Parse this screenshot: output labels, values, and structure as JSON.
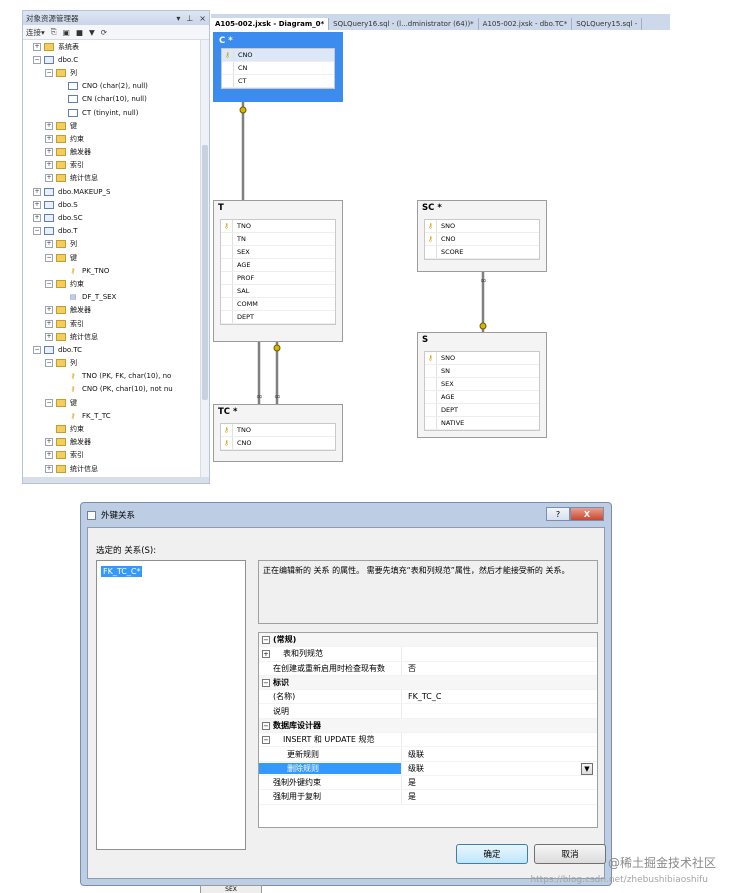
{
  "explorer": {
    "title": "对象资源管理器",
    "title_controls": [
      "▾",
      "⊥",
      "×"
    ],
    "toolbar": [
      "连接▾",
      "⎘",
      "▣",
      "■",
      "▼",
      "⟳"
    ],
    "tree": [
      {
        "indent": 1,
        "exp": "+",
        "icon": "folder",
        "label": "系统表"
      },
      {
        "indent": 1,
        "exp": "−",
        "icon": "table",
        "label": "dbo.C"
      },
      {
        "indent": 2,
        "exp": "−",
        "icon": "folder",
        "label": "列"
      },
      {
        "indent": 3,
        "exp": "",
        "icon": "col",
        "label": "CNO (char(2), null)"
      },
      {
        "indent": 3,
        "exp": "",
        "icon": "col",
        "label": "CN (char(10), null)"
      },
      {
        "indent": 3,
        "exp": "",
        "icon": "col",
        "label": "CT (tinyint, null)"
      },
      {
        "indent": 2,
        "exp": "+",
        "icon": "folder",
        "label": "键"
      },
      {
        "indent": 2,
        "exp": "+",
        "icon": "folder",
        "label": "约束"
      },
      {
        "indent": 2,
        "exp": "+",
        "icon": "folder",
        "label": "触发器"
      },
      {
        "indent": 2,
        "exp": "+",
        "icon": "folder",
        "label": "索引"
      },
      {
        "indent": 2,
        "exp": "+",
        "icon": "folder",
        "label": "统计信息"
      },
      {
        "indent": 1,
        "exp": "+",
        "icon": "table",
        "label": "dbo.MAKEUP_S"
      },
      {
        "indent": 1,
        "exp": "+",
        "icon": "table",
        "label": "dbo.S"
      },
      {
        "indent": 1,
        "exp": "+",
        "icon": "table",
        "label": "dbo.SC"
      },
      {
        "indent": 1,
        "exp": "−",
        "icon": "table",
        "label": "dbo.T"
      },
      {
        "indent": 2,
        "exp": "+",
        "icon": "folder",
        "label": "列"
      },
      {
        "indent": 2,
        "exp": "−",
        "icon": "folder",
        "label": "键"
      },
      {
        "indent": 3,
        "exp": "",
        "icon": "key",
        "label": "PK_TNO"
      },
      {
        "indent": 2,
        "exp": "−",
        "icon": "folder",
        "label": "约束"
      },
      {
        "indent": 3,
        "exp": "",
        "icon": "cons",
        "label": "DF_T_SEX"
      },
      {
        "indent": 2,
        "exp": "+",
        "icon": "folder",
        "label": "触发器"
      },
      {
        "indent": 2,
        "exp": "+",
        "icon": "folder",
        "label": "索引"
      },
      {
        "indent": 2,
        "exp": "+",
        "icon": "folder",
        "label": "统计信息"
      },
      {
        "indent": 1,
        "exp": "−",
        "icon": "table",
        "label": "dbo.TC"
      },
      {
        "indent": 2,
        "exp": "−",
        "icon": "folder",
        "label": "列"
      },
      {
        "indent": 3,
        "exp": "",
        "icon": "key",
        "label": "TNO (PK, FK, char(10), no"
      },
      {
        "indent": 3,
        "exp": "",
        "icon": "key",
        "label": "CNO (PK, char(10), not nu"
      },
      {
        "indent": 2,
        "exp": "−",
        "icon": "folder",
        "label": "键"
      },
      {
        "indent": 3,
        "exp": "",
        "icon": "key",
        "label": "FK_T_TC"
      },
      {
        "indent": 2,
        "exp": "",
        "icon": "folder",
        "label": "约束"
      },
      {
        "indent": 2,
        "exp": "+",
        "icon": "folder",
        "label": "触发器"
      },
      {
        "indent": 2,
        "exp": "+",
        "icon": "folder",
        "label": "索引"
      },
      {
        "indent": 2,
        "exp": "+",
        "icon": "folder",
        "label": "统计信息"
      }
    ]
  },
  "tabs": [
    {
      "label": "A105-002.jxsk - Diagram_0*",
      "active": true
    },
    {
      "label": "SQLQuery16.sql - (l...dministrator (64))*",
      "active": false
    },
    {
      "label": "A105-002.jxsk - dbo.TC*",
      "active": false
    },
    {
      "label": "SQLQuery15.sql -",
      "active": false
    }
  ],
  "diagram": {
    "tables": [
      {
        "id": "C",
        "title": "C *",
        "selected": true,
        "columns": [
          {
            "name": "CNO",
            "key": true
          },
          {
            "name": "CN",
            "key": false
          },
          {
            "name": "CT",
            "key": false
          }
        ]
      },
      {
        "id": "T",
        "title": "T",
        "selected": false,
        "columns": [
          {
            "name": "TNO",
            "key": true
          },
          {
            "name": "TN",
            "key": false
          },
          {
            "name": "SEX",
            "key": false
          },
          {
            "name": "AGE",
            "key": false
          },
          {
            "name": "PROF",
            "key": false
          },
          {
            "name": "SAL",
            "key": false
          },
          {
            "name": "COMM",
            "key": false
          },
          {
            "name": "DEPT",
            "key": false
          }
        ]
      },
      {
        "id": "SC",
        "title": "SC *",
        "selected": false,
        "columns": [
          {
            "name": "SNO",
            "key": true
          },
          {
            "name": "CNO",
            "key": true
          },
          {
            "name": "SCORE",
            "key": false
          }
        ]
      },
      {
        "id": "S",
        "title": "S",
        "selected": false,
        "columns": [
          {
            "name": "SNO",
            "key": true
          },
          {
            "name": "SN",
            "key": false
          },
          {
            "name": "SEX",
            "key": false
          },
          {
            "name": "AGE",
            "key": false
          },
          {
            "name": "DEPT",
            "key": false
          },
          {
            "name": "NATIVE",
            "key": false
          }
        ]
      },
      {
        "id": "TC",
        "title": "TC *",
        "selected": false,
        "columns": [
          {
            "name": "TNO",
            "key": true
          },
          {
            "name": "CNO",
            "key": true
          }
        ]
      }
    ]
  },
  "dialog": {
    "title": "外键关系",
    "help_label": "?",
    "close_label": "X",
    "selected_label": "选定的 关系(S):",
    "relation_item": "FK_TC_C*",
    "description": "正在编辑新的 关系 的属性。 需要先填充“表和列规范”属性，然后才能接受新的 关系。",
    "properties": [
      {
        "kind": "cat",
        "exp": "−",
        "label": "(常规)",
        "value": ""
      },
      {
        "kind": "sub2",
        "exp": "+",
        "label": "表和列规范",
        "value": ""
      },
      {
        "kind": "prop",
        "exp": "",
        "label": "在创建或重新启用时检查现有数",
        "value": "否"
      },
      {
        "kind": "cat",
        "exp": "−",
        "label": "标识",
        "value": ""
      },
      {
        "kind": "prop",
        "exp": "",
        "label": "(名称)",
        "value": "FK_TC_C"
      },
      {
        "kind": "prop",
        "exp": "",
        "label": "说明",
        "value": ""
      },
      {
        "kind": "cat",
        "exp": "−",
        "label": "数据库设计器",
        "value": ""
      },
      {
        "kind": "sub2",
        "exp": "−",
        "label": "INSERT 和 UPDATE 规范",
        "value": ""
      },
      {
        "kind": "sub",
        "exp": "",
        "label": "更新规则",
        "value": "级联"
      },
      {
        "kind": "sub",
        "exp": "",
        "label": "删除规则",
        "value": "级联",
        "highlight": true,
        "dropdown": true
      },
      {
        "kind": "prop",
        "exp": "",
        "label": "强制外键约束",
        "value": "是"
      },
      {
        "kind": "prop",
        "exp": "",
        "label": "强制用于复制",
        "value": "是"
      }
    ],
    "ok_label": "确定",
    "cancel_label": "取消"
  },
  "watermark": {
    "line1": "@稀土掘金技术社区",
    "line2": "https://blog.csdn.net/zhebushibiaoshifu"
  },
  "peek_label": "SEX"
}
